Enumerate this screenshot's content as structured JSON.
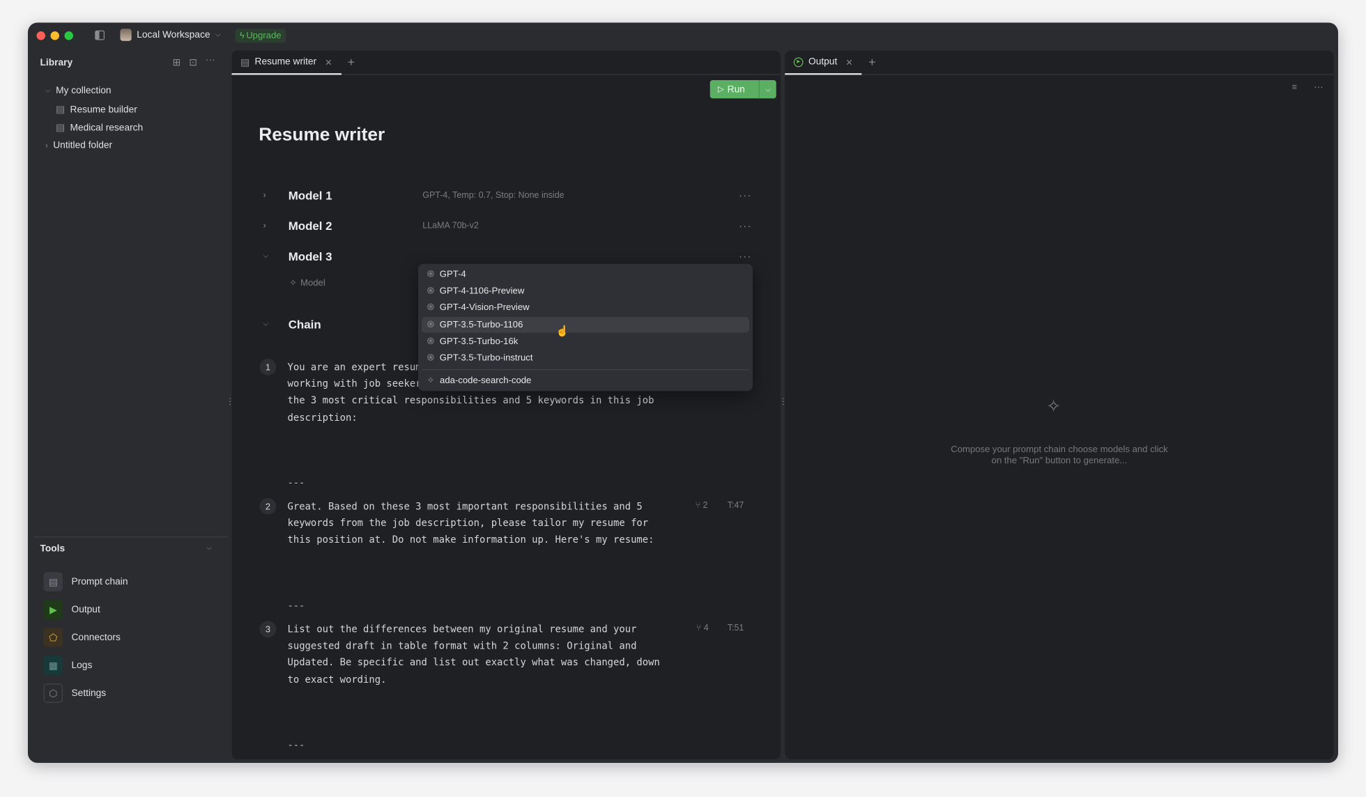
{
  "titlebar": {
    "workspace": "Local Workspace",
    "upgrade_label": "Upgrade"
  },
  "library": {
    "title": "Library",
    "collection": "My collection",
    "items": [
      {
        "label": "Resume builder"
      },
      {
        "label": "Medical research"
      }
    ],
    "folder": "Untitled folder"
  },
  "tools": {
    "title": "Tools",
    "items": [
      {
        "label": "Prompt chain",
        "icon": "document-icon",
        "color": "#8a8b90"
      },
      {
        "label": "Output",
        "icon": "play-icon",
        "color": "#5cc04a"
      },
      {
        "label": "Connectors",
        "icon": "puzzle-icon",
        "color": "#e8b93c"
      },
      {
        "label": "Logs",
        "icon": "table-icon",
        "color": "#2fb59a"
      },
      {
        "label": "Settings",
        "icon": "hexagon-gear-icon",
        "color": "#8a8b90"
      }
    ]
  },
  "editor": {
    "tab_label": "Resume writer",
    "run_label": "Run",
    "title": "Resume writer",
    "models": [
      {
        "label": "Model 1",
        "desc": "GPT-4, Temp: 0.7, Stop: None inside",
        "expanded": false
      },
      {
        "label": "Model 2",
        "desc": "LLaMA 70b-v2",
        "expanded": false
      },
      {
        "label": "Model 3",
        "desc": "",
        "expanded": true
      }
    ],
    "model_picker_label": "Model",
    "chain_label": "Chain",
    "steps": [
      {
        "num": "1",
        "text": "You are an expert resume writer with over 20 years of experience\nworking with job seekers. Please identify\nthe 3 most critical responsibilities and 5 keywords in this job\ndescription:",
        "branches": "",
        "tokens": ""
      },
      {
        "num": "2",
        "text": "Great. Based on these 3 most important responsibilities and 5\nkeywords from the job description, please tailor my resume for\nthis position at. Do not make information up. Here's my resume:",
        "branches": "2",
        "tokens": "T:47"
      },
      {
        "num": "3",
        "text": "List out the differences between my original resume and your\nsuggested draft in table format with 2 columns: Original and\nUpdated. Be specific and list out exactly what was changed, down\nto exact wording.",
        "branches": "4",
        "tokens": "T:51"
      }
    ],
    "separator": "---"
  },
  "dropdown": {
    "options": [
      {
        "label": "GPT-4",
        "icon": "openai-icon"
      },
      {
        "label": "GPT-4-1106-Preview",
        "icon": "openai-icon"
      },
      {
        "label": "GPT-4-Vision-Preview",
        "icon": "openai-icon"
      },
      {
        "label": "GPT-3.5-Turbo-1106",
        "icon": "openai-icon",
        "highlighted": true
      },
      {
        "label": "GPT-3.5-Turbo-16k",
        "icon": "openai-icon"
      },
      {
        "label": "GPT-3.5-Turbo-instruct",
        "icon": "openai-icon"
      }
    ],
    "extra": {
      "label": "ada-code-search-code",
      "icon": "sparkle-icon"
    }
  },
  "output": {
    "tab_label": "Output",
    "empty_text_line1": "Compose your prompt chain choose models and click",
    "empty_text_line2": "on the \"Run\" button to generate..."
  },
  "colors": {
    "accent_green": "#5aaf62",
    "window_bg": "#2b2c30",
    "panel_bg": "#1f2024"
  }
}
